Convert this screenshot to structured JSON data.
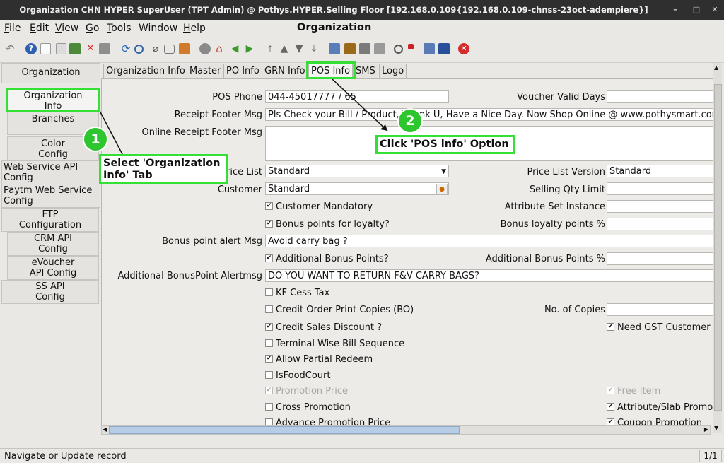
{
  "window": {
    "title": "Organization  CHN  HYPER  SuperUser (TPT Admin) @ Pothys.HYPER.Selling Floor [192.168.0.109{192.168.0.109-chnss-23oct-adempiere}]",
    "minimize": "–",
    "maximize": "□",
    "close": "✕"
  },
  "menu": {
    "items": [
      {
        "u": "F",
        "rest": "ile"
      },
      {
        "u": "E",
        "rest": "dit"
      },
      {
        "u": "V",
        "rest": "iew"
      },
      {
        "u": "G",
        "rest": "o"
      },
      {
        "u": "T",
        "rest": "ools"
      },
      {
        "u": "",
        "rest": "Window"
      },
      {
        "u": "H",
        "rest": "elp"
      }
    ],
    "app_title": "Organization"
  },
  "toolbar": {
    "icons": [
      "undo-icon",
      "help-icon",
      "new-icon",
      "copy-icon",
      "save-icon",
      "delete-icon",
      "print-preview-icon",
      "refresh-icon",
      "find-icon",
      "attachment-icon",
      "chat-icon",
      "grid-toggle-icon",
      "history-icon",
      "home-icon",
      "back-icon",
      "forward-icon",
      "first-record-icon",
      "previous-record-icon",
      "next-record-icon",
      "last-record-icon",
      "report-icon",
      "archive-icon",
      "print-icon",
      "print-alt-icon",
      "zoom-across-icon",
      "workflow-icon",
      "product-info-icon",
      "exit-icon"
    ]
  },
  "sidebar": {
    "items": [
      {
        "label": "Organization"
      },
      {
        "label": "Organization Info"
      },
      {
        "label": "Branches"
      },
      {
        "label": "Color Config"
      },
      {
        "label": "Web Service API Config"
      },
      {
        "label": "Paytm Web Service Config"
      },
      {
        "label": "FTP Configuration"
      },
      {
        "label": "CRM API Config"
      },
      {
        "label": "eVoucher API Config"
      },
      {
        "label": "SS API Config"
      }
    ]
  },
  "tabs": [
    "Organization Info",
    "Master",
    "PO Info",
    "GRN Info",
    "POS Info",
    "SMS",
    "Logo"
  ],
  "form": {
    "pos_phone_label": "POS Phone",
    "pos_phone_value": "044-45017777  / 65",
    "voucher_valid_days_label": "Voucher Valid Days",
    "voucher_valid_days_value": "",
    "receipt_footer_label": "Receipt Footer Msg",
    "receipt_footer_value": "Pls Check your Bill / Product, Thank U, Have a Nice Day. Now Shop Online @ www.pothysmart.com",
    "online_receipt_footer_label": "Online Receipt Footer Msg",
    "price_list_label": "Price List",
    "price_list_value": "Standard",
    "price_list_version_label": "Price List Version",
    "price_list_version_value": "Standard",
    "customer_label": "Customer",
    "customer_value": "Standard",
    "selling_qty_limit_label": "Selling Qty Limit",
    "customer_mandatory": "Customer Mandatory",
    "attribute_set_instance_label": "Attribute Set Instance",
    "bonus_points_loyalty": "Bonus points for loyalty?",
    "bonus_loyalty_pct_label": "Bonus loyalty points %",
    "bonus_alert_label": "Bonus point alert Msg",
    "bonus_alert_value": "Avoid carry bag ?",
    "additional_bonus": "Additional Bonus Points?",
    "additional_bonus_pct_label": "Additional Bonus Points %",
    "additional_alert_label": "Additional BonusPoint Alertmsg",
    "additional_alert_value": "DO YOU WANT TO RETURN F&V CARRY BAGS?",
    "kf_cess": "KF Cess Tax",
    "credit_order_copies": "Credit Order Print Copies (BO)",
    "no_of_copies_label": "No. of Copies",
    "credit_sales_discount": "Credit Sales Discount ?",
    "need_gst": "Need GST Customer In",
    "terminal_wise": "Terminal Wise Bill Sequence",
    "allow_partial": "Allow Partial Redeem",
    "is_food_court": "IsFoodCourt",
    "promotion_price": "Promotion Price",
    "free_item": "Free Item",
    "cross_promotion": "Cross Promotion",
    "attribute_slab_promo": "Attribute/Slab Promo",
    "advance_promotion": "Advance Promotion Price",
    "coupon_promotion": "Coupon Promotion"
  },
  "annotations": {
    "step1_number": "1",
    "step1_text_line1": "Select 'Organization",
    "step1_text_line2": "Info' Tab",
    "step2_number": "2",
    "step2_text": "Click 'POS info' Option"
  },
  "status": {
    "message": "Navigate or Update record",
    "record_count": "1/1"
  },
  "colors": {
    "accent_green": "#33e033",
    "badge_green": "#2ec62e"
  }
}
